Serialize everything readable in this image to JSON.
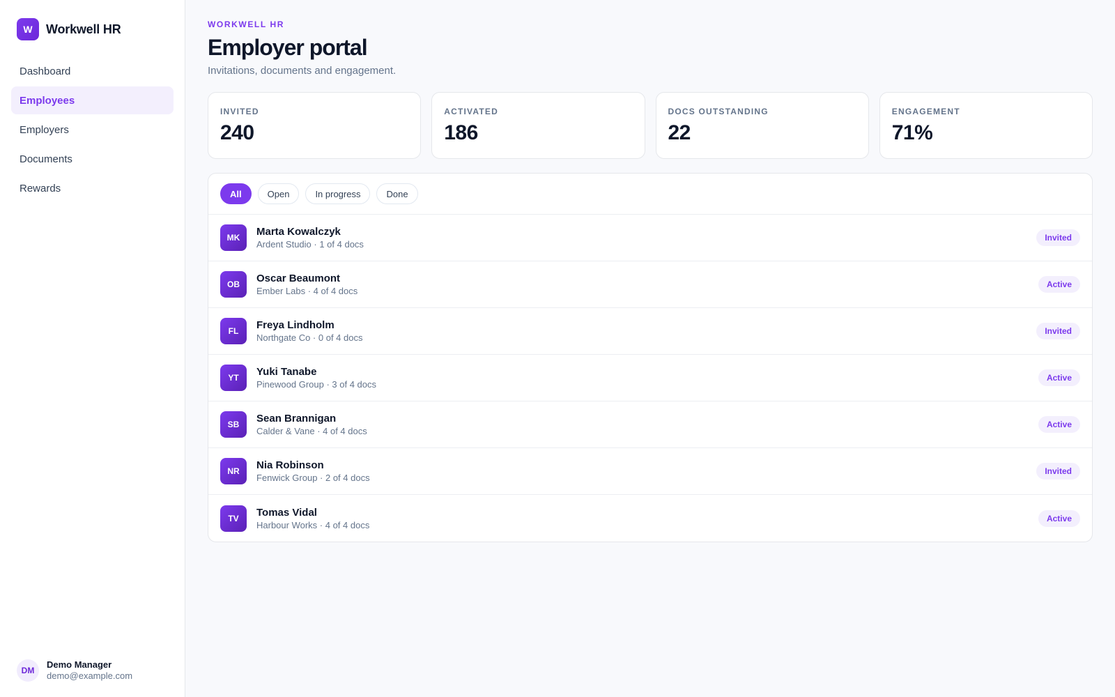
{
  "brand": {
    "logo_letter": "W",
    "name": "Workwell HR"
  },
  "sidebar": {
    "items": [
      {
        "label": "Dashboard",
        "active": false
      },
      {
        "label": "Employees",
        "active": true
      },
      {
        "label": "Employers",
        "active": false
      },
      {
        "label": "Documents",
        "active": false
      },
      {
        "label": "Rewards",
        "active": false
      }
    ]
  },
  "user": {
    "initials": "DM",
    "name": "Demo Manager",
    "email": "demo@example.com"
  },
  "header": {
    "eyebrow": "WORKWELL HR",
    "title": "Employer portal",
    "subtitle": "Invitations, documents and engagement."
  },
  "stats": [
    {
      "label": "INVITED",
      "value": "240"
    },
    {
      "label": "ACTIVATED",
      "value": "186"
    },
    {
      "label": "DOCS OUTSTANDING",
      "value": "22"
    },
    {
      "label": "ENGAGEMENT",
      "value": "71%"
    }
  ],
  "filters": [
    {
      "label": "All",
      "active": true
    },
    {
      "label": "Open",
      "active": false
    },
    {
      "label": "In progress",
      "active": false
    },
    {
      "label": "Done",
      "active": false
    }
  ],
  "employees": [
    {
      "initials": "MK",
      "name": "Marta Kowalczyk",
      "meta": "Ardent Studio · 1 of 4 docs",
      "status": "Invited"
    },
    {
      "initials": "OB",
      "name": "Oscar Beaumont",
      "meta": "Ember Labs · 4 of 4 docs",
      "status": "Active"
    },
    {
      "initials": "FL",
      "name": "Freya Lindholm",
      "meta": "Northgate Co · 0 of 4 docs",
      "status": "Invited"
    },
    {
      "initials": "YT",
      "name": "Yuki Tanabe",
      "meta": "Pinewood Group · 3 of 4 docs",
      "status": "Active"
    },
    {
      "initials": "SB",
      "name": "Sean Brannigan",
      "meta": "Calder & Vane · 4 of 4 docs",
      "status": "Active"
    },
    {
      "initials": "NR",
      "name": "Nia Robinson",
      "meta": "Fenwick Group · 2 of 4 docs",
      "status": "Invited"
    },
    {
      "initials": "TV",
      "name": "Tomas Vidal",
      "meta": "Harbour Works · 4 of 4 docs",
      "status": "Active"
    }
  ],
  "colors": {
    "accent": "#7c3aed",
    "accent_soft": "#f3effd",
    "text": "#0f172a",
    "muted": "#64748b"
  }
}
